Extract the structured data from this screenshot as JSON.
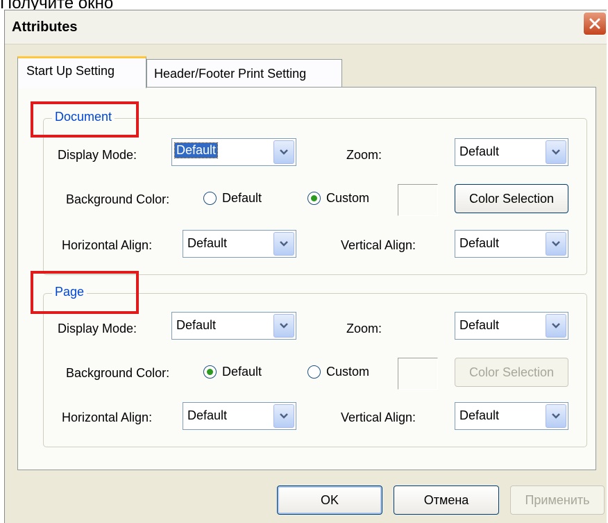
{
  "caption": "Получите окно",
  "window": {
    "title": "Attributes"
  },
  "tabs": [
    {
      "label": "Start Up Setting",
      "active": true
    },
    {
      "label": "Header/Footer Print Setting",
      "active": false
    }
  ],
  "document": {
    "legend": "Document",
    "display_mode_label": "Display Mode:",
    "display_mode_value": "Default",
    "zoom_label": "Zoom:",
    "zoom_value": "Default",
    "bg_color_label": "Background Color:",
    "radio_default_label": "Default",
    "radio_custom_label": "Custom",
    "selected_radio": "Custom",
    "color_selection_label": "Color Selection",
    "h_align_label": "Horizontal Align:",
    "h_align_value": "Default",
    "v_align_label": "Vertical Align:",
    "v_align_value": "Default"
  },
  "page": {
    "legend": "Page",
    "display_mode_label": "Display Mode:",
    "display_mode_value": "Default",
    "zoom_label": "Zoom:",
    "zoom_value": "Default",
    "bg_color_label": "Background Color:",
    "radio_default_label": "Default",
    "radio_custom_label": "Custom",
    "selected_radio": "Default",
    "color_selection_label": "Color Selection",
    "h_align_label": "Horizontal Align:",
    "h_align_value": "Default",
    "v_align_label": "Vertical Align:",
    "v_align_value": "Default"
  },
  "buttons": {
    "ok": "OK",
    "cancel": "Отмена",
    "apply": "Применить"
  },
  "colors": {
    "highlight": "#e01b1b",
    "legend": "#0046d5",
    "tab_accent": "#ffc83c",
    "dialog_bg": "#ece9d8"
  },
  "icons": [
    "close-icon",
    "chevron-down-icon"
  ]
}
